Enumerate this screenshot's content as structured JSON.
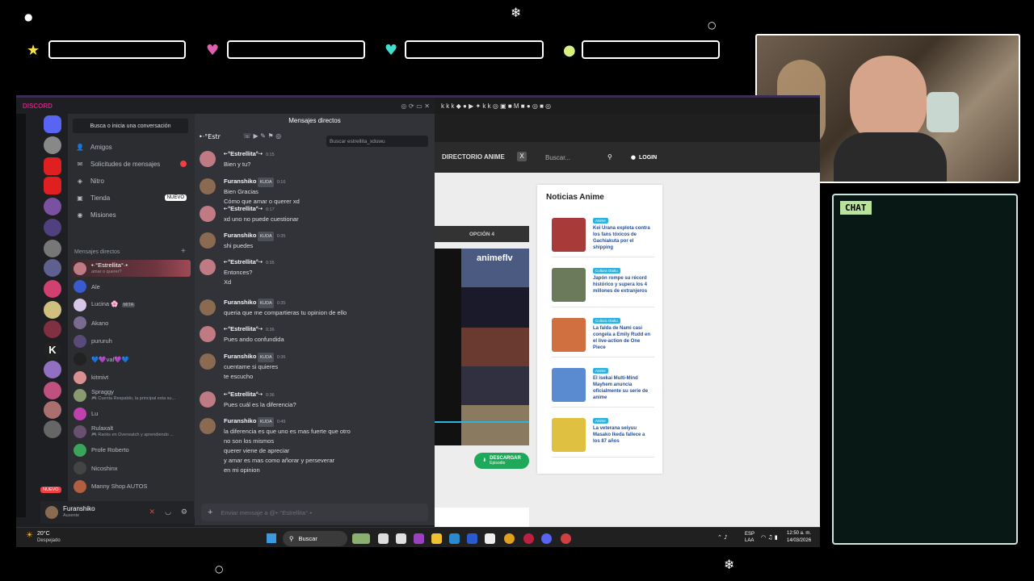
{
  "overlay": {
    "chat_label": "CHAT"
  },
  "discord": {
    "window_title": "DISCORD",
    "search_conversation": "Busca o inicia una conversación",
    "nav": [
      {
        "label": "Amigos",
        "icon": "friends-icon"
      },
      {
        "label": "Solicitudes de mensajes",
        "icon": "mail-icon"
      },
      {
        "label": "Nitro",
        "icon": "nitro-icon"
      },
      {
        "label": "Tienda",
        "icon": "shop-icon",
        "badge": "NUEVO"
      },
      {
        "label": "Misiones",
        "icon": "quests-icon"
      }
    ],
    "dm_header": "Mensajes directos",
    "dms": [
      {
        "name": "•·°Estrellita°·•",
        "sub": "amar o querer?",
        "color": "#c07a84",
        "active": true
      },
      {
        "name": "Ale",
        "sub": "",
        "color": "#3a5ad0"
      },
      {
        "name": "Lucina 🌸",
        "sub": "",
        "tag": "MITA",
        "color": "#d8c8e8"
      },
      {
        "name": "Akano",
        "sub": "",
        "color": "#7a6a90"
      },
      {
        "name": "pururuh",
        "sub": "",
        "color": "#5a4a7a"
      },
      {
        "name": "💙💜val💜💙",
        "sub": "",
        "color": "#222"
      },
      {
        "name": "kitmivt",
        "sub": "",
        "color": "#d89090"
      },
      {
        "name": "Spraggy",
        "sub": "🎮 Cuenta Respaldo, la principal esta su...",
        "color": "#8a9a70"
      },
      {
        "name": "Lu",
        "sub": "",
        "color": "#c040b0"
      },
      {
        "name": "Rulaxalt",
        "sub": "🎮 Ranks en Overwatch y aprendiendo ...",
        "color": "#6a5070"
      },
      {
        "name": "Profe Roberto",
        "sub": "",
        "color": "#3aa55a"
      },
      {
        "name": "Nicoshinx",
        "sub": "",
        "color": "#444"
      },
      {
        "name": "Manny Shop AUTOS",
        "sub": "",
        "color": "#b06040"
      }
    ],
    "user": {
      "name": "Furanshiko",
      "status": "Ausente"
    },
    "chat": {
      "header": "Mensajes directos",
      "recipient": "•·°Estr",
      "search_placeholder": "Buscar estrellita_xduwu",
      "composer_placeholder": "Enviar mensaje a @•·°Estrellita°·•",
      "messages": [
        {
          "author": "•·°Estrellita°·•",
          "time": "0:15",
          "lines": [
            "Bien y tu?"
          ],
          "avatar": "#c07a84"
        },
        {
          "author": "Furanshiko",
          "tag": "KUDA",
          "time": "0:16",
          "lines": [
            "Bien Gracias",
            "Cómo que amar o querer xd"
          ],
          "avatar": "#8a6a50"
        },
        {
          "author": "•·°Estrellita°·•",
          "time": "0:17",
          "lines": [
            "xd uno no puede cuestionar"
          ],
          "avatar": "#c07a84"
        },
        {
          "author": "Furanshiko",
          "tag": "KUDA",
          "time": "0:35",
          "lines": [
            "shi puedes"
          ],
          "avatar": "#8a6a50"
        },
        {
          "author": "•·°Estrellita°·•",
          "time": "0:35",
          "lines": [
            "Entonces?",
            "Xd"
          ],
          "avatar": "#c07a84"
        },
        {
          "author": "Furanshiko",
          "tag": "KUDA",
          "time": "0:35",
          "lines": [
            "queria que me compartieras tu opinion de ello"
          ],
          "avatar": "#8a6a50"
        },
        {
          "author": "•·°Estrellita°·•",
          "time": "0:36",
          "lines": [
            "Pues ando confundida"
          ],
          "avatar": "#c07a84"
        },
        {
          "author": "Furanshiko",
          "tag": "KUDA",
          "time": "0:36",
          "lines": [
            "cuentame si quieres",
            "te escucho"
          ],
          "avatar": "#8a6a50"
        },
        {
          "author": "•·°Estrellita°·•",
          "time": "0:36",
          "lines": [
            "Pues cuál es la diferencia?"
          ],
          "avatar": "#c07a84"
        },
        {
          "author": "Furanshiko",
          "tag": "KUDA",
          "time": "0:49",
          "lines": [
            "la diferencia es que uno es mas fuerte que otro",
            "no son los mismos",
            "querer viene de apreciar",
            "y amar es mas como añorar y perseverar",
            "en mi opinion"
          ],
          "avatar": "#8a6a50"
        }
      ]
    }
  },
  "browser": {
    "nav_link": "DIRECTORIO ANIME",
    "search_placeholder": "Buscar...",
    "login": "LOGIN",
    "option_label": "OPCIÓN 4",
    "download_label": "DESCARGAR",
    "download_sub": "Episodio",
    "video_text": "animeflv",
    "news": {
      "title": "Noticias Anime",
      "items": [
        {
          "category": "Anime",
          "headline": "Kei Urana explota contra los fans tóxicos de Gachiakuta por el shipping",
          "thumb": "#a83a3a"
        },
        {
          "category": "Cultura Otaku",
          "headline": "Japón rompe su récord histórico y supera los 4 millones de extranjeros",
          "thumb": "#6a7a5a"
        },
        {
          "category": "Cultura Otaku",
          "headline": "La falda de Nami casi congela a Emily Rudd en el live-action de One Piece",
          "thumb": "#d07040"
        },
        {
          "category": "Anime",
          "headline": "El isekai Multi-Mind Mayhem anuncia oficialmente su serie de anime",
          "thumb": "#5a8ad0"
        },
        {
          "category": "Anime",
          "headline": "La veterana seiyuu Masako Ikeda fallece a los 87 años",
          "thumb": "#e0c040"
        }
      ]
    }
  },
  "taskbar": {
    "weather_temp": "20°C",
    "weather_desc": "Despejado",
    "search": "Buscar",
    "lang": "ESP",
    "lang_sub": "LAA",
    "time": "12:50 a. m.",
    "date": "14/03/2026"
  },
  "server_badge": "NUEVO"
}
